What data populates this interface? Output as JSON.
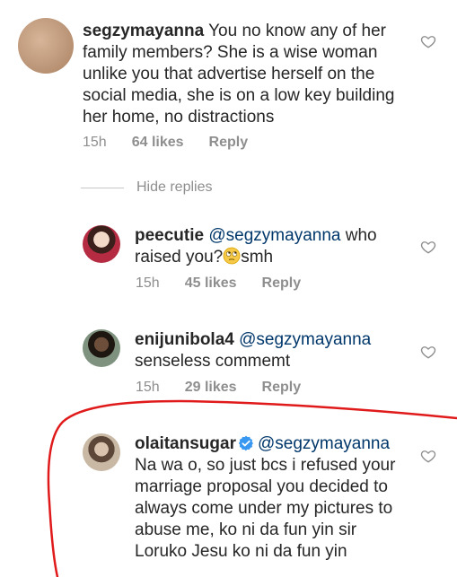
{
  "comments": [
    {
      "username": "segzymayanna",
      "text": " You no know any of her family members? She is a wise woman unlike you that advertise herself on the social media, she is on a low key building her home, no distractions",
      "time": "15h",
      "likes": "64 likes",
      "reply": "Reply"
    }
  ],
  "hide_replies": "Hide replies",
  "replies": [
    {
      "username": "peecutie",
      "mention": "@segzymayanna",
      "text_a": " who raised you?",
      "emoji": "rolling-eyes-emoji",
      "text_b": "smh",
      "time": "15h",
      "likes": "45 likes",
      "reply": "Reply"
    },
    {
      "username": "enijunibola4",
      "mention": "@segzymayanna",
      "text": "senseless commemt",
      "time": "15h",
      "likes": "29 likes",
      "reply": "Reply"
    },
    {
      "username": "olaitansugar",
      "verified": true,
      "mention": "@segzymayanna",
      "text": "Na wa o, so just bcs i refused your marriage proposal you decided to always come under my pictures to abuse me, ko ni da fun yin sir Loruko Jesu ko ni da fun yin"
    }
  ],
  "colors": {
    "text": "#262626",
    "meta": "#8e8e8e",
    "mention": "#00376b",
    "verified": "#3897f0",
    "annotation": "#e01a1a"
  }
}
